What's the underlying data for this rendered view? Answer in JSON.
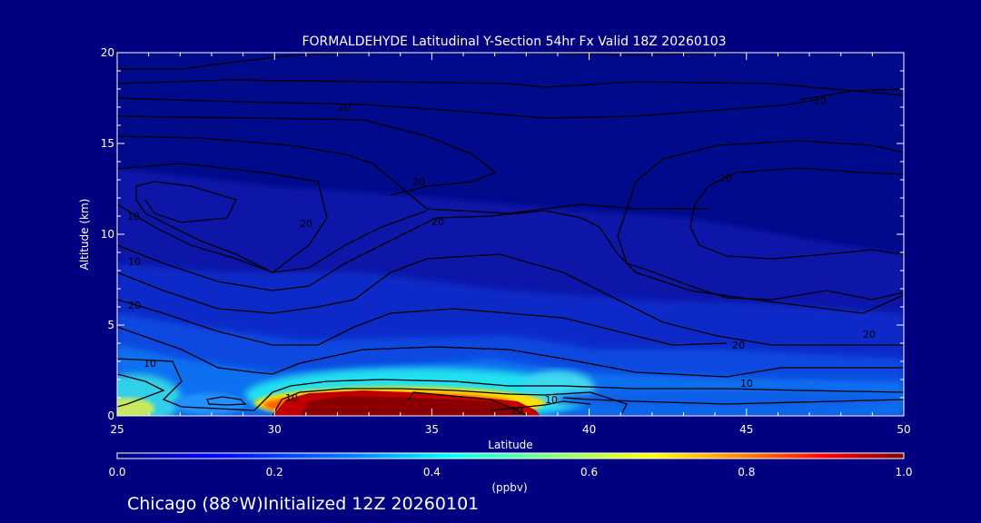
{
  "chart_data": {
    "type": "heatmap",
    "title": "FORMALDEHYDE Latitudinal Y-Section 54hr  Fx Valid 18Z 20260103",
    "xlabel": "Latitude",
    "ylabel": "Altitude (km)",
    "xlim": [
      25,
      50
    ],
    "ylim": [
      0,
      20
    ],
    "x_ticks": [
      "25",
      "30",
      "35",
      "40",
      "45",
      "50"
    ],
    "y_ticks": [
      "0",
      "5",
      "10",
      "15",
      "20"
    ],
    "colorbar": {
      "label": "(ppbv)",
      "range": [
        0.0,
        1.0
      ],
      "ticks": [
        "0.0",
        "0.2",
        "0.4",
        "0.6",
        "0.8",
        "1.0"
      ],
      "colors": [
        "#000080",
        "#0000ff",
        "#0080ff",
        "#00ffff",
        "#80ff80",
        "#ffff00",
        "#ff8000",
        "#ff0000",
        "#800000"
      ]
    },
    "contour_labels": [
      "20",
      "20",
      "20",
      "20",
      "20",
      "10",
      "10",
      "20",
      "10",
      "10",
      "20",
      "10",
      "20",
      "20",
      "10",
      "10"
    ]
  },
  "footer": "Chicago (88°W)Initialized 12Z 20260101"
}
